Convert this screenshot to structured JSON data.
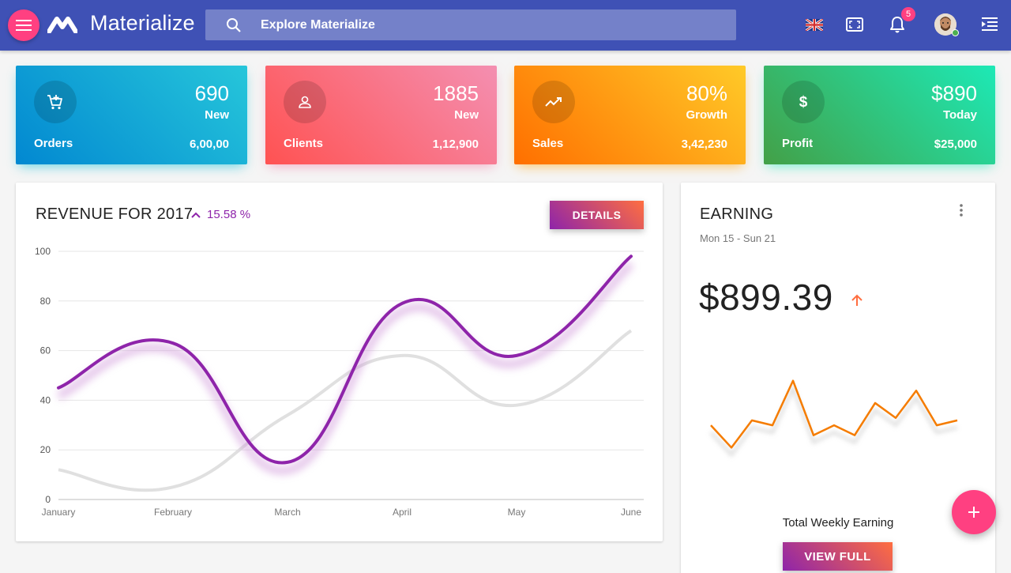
{
  "app": {
    "brand": "Materialize"
  },
  "header": {
    "search_placeholder": "Explore Materialize",
    "notifications_count": "5",
    "icons": [
      "menu-icon",
      "materialize-logo-icon",
      "search-icon",
      "uk-flag-icon",
      "fullscreen-icon",
      "bell-icon",
      "avatar",
      "list-collapse-icon"
    ]
  },
  "stats": [
    {
      "value": "690",
      "sub": "New",
      "label": "Orders",
      "total": "6,00,00",
      "icon": "cart-add-icon"
    },
    {
      "value": "1885",
      "sub": "New",
      "label": "Clients",
      "total": "1,12,900",
      "icon": "person-icon"
    },
    {
      "value": "80%",
      "sub": "Growth",
      "label": "Sales",
      "total": "3,42,230",
      "icon": "trending-icon"
    },
    {
      "value": "$890",
      "sub": "Today",
      "label": "Profit",
      "total": "$25,000",
      "icon": "dollar-icon"
    }
  ],
  "revenue": {
    "title": "REVENUE FOR 2017",
    "trend": "15.58 %",
    "details_button": "DETAILS"
  },
  "earning": {
    "title": "EARNING",
    "date_range": "Mon 15 - Sun 21",
    "amount": "$899.39",
    "caption": "Total Weekly Earning",
    "view_button": "VIEW FULL"
  },
  "colors": {
    "topbar": "#3f51b5",
    "accent": "#ff4081",
    "purple": "#8e24aa",
    "orange": "#ff6e40",
    "series_primary": "#8e24aa",
    "series_secondary": "#e0e0e0",
    "weekly_line": "#f57c00"
  },
  "chart_data": [
    {
      "type": "line",
      "categories": [
        "January",
        "February",
        "March",
        "April",
        "May",
        "June"
      ],
      "ylim": [
        0,
        100
      ],
      "yticks": [
        0,
        20,
        40,
        60,
        80,
        100
      ],
      "grid": true,
      "series": [
        {
          "values": [
            45,
            63,
            15,
            79,
            58,
            98
          ]
        },
        {
          "values": [
            12,
            5,
            34,
            58,
            38,
            68
          ]
        }
      ]
    },
    {
      "type": "line",
      "x": [
        1,
        2,
        3,
        4,
        5,
        6,
        7,
        8,
        9,
        10,
        11,
        12,
        13
      ],
      "series": [
        {
          "values": [
            29,
            20,
            31,
            29,
            47,
            25,
            29,
            25,
            38,
            32,
            43,
            29,
            31
          ]
        }
      ],
      "ylim": [
        0,
        60
      ],
      "grid": false
    }
  ]
}
